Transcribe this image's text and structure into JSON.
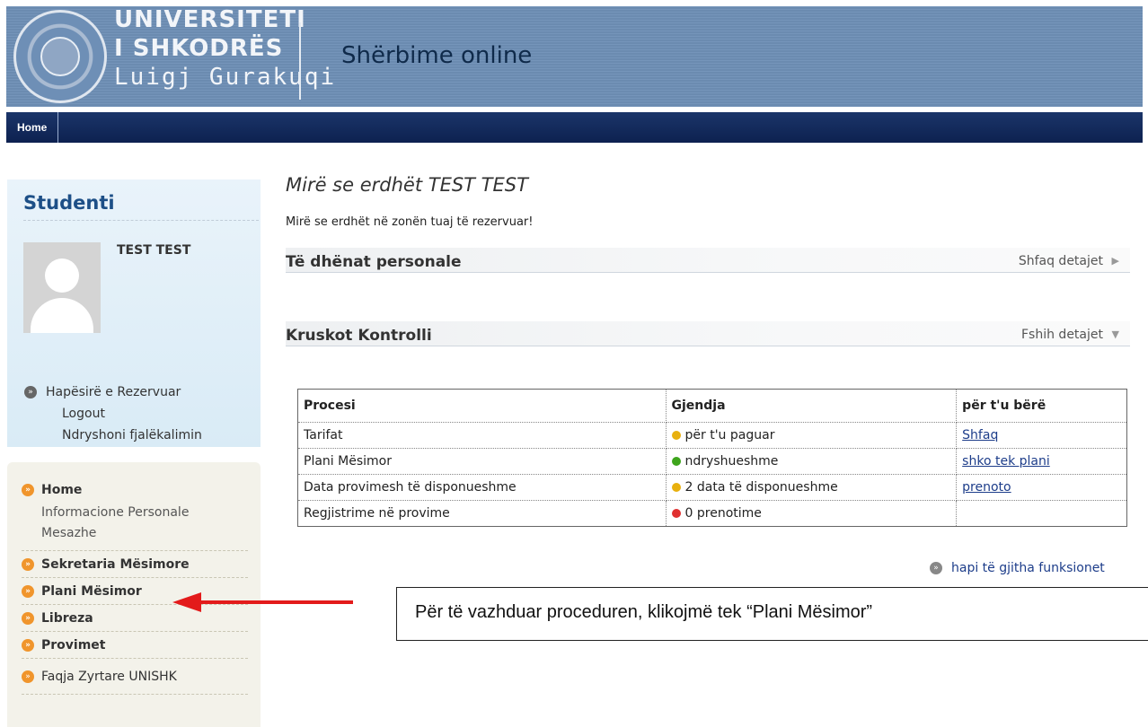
{
  "header": {
    "university_line1": "UNIVERSITETI",
    "university_line2": "I SHKODRËS",
    "university_line3": "Luigj Gurakuqi",
    "service_title": "Shërbime online",
    "logo_icon": "university-seal-icon"
  },
  "navbar": {
    "home_label": "Home"
  },
  "sidebar": {
    "title": "Studenti",
    "student_name": "TEST TEST",
    "links": [
      "Hapësirë e Rezervuar",
      "Logout",
      "Ndryshoni fjalëkalimin"
    ],
    "menu": {
      "home": "Home",
      "home_sub": [
        "Informacione Personale",
        "Mesazhe"
      ],
      "items": [
        "Sekretaria Mësimore",
        "Plani Mësimor",
        "Libreza",
        "Provimet",
        "Faqja Zyrtare UNISHK"
      ]
    }
  },
  "main": {
    "title": "Mirë se erdhët  TEST TEST",
    "subtitle": "Mirë se erdhët në zonën tuaj të rezervuar!",
    "personal_section": {
      "title": "Të dhënat personale",
      "toggle": "Shfaq detajet"
    },
    "control_section": {
      "title": "Kruskot Kontrolli",
      "toggle": "Fshih detajet"
    },
    "table": {
      "headers": [
        "Procesi",
        "Gjendja",
        "për t'u bërë"
      ],
      "rows": [
        {
          "process": "Tarifat",
          "status": "për t'u paguar",
          "status_color": "#e8b00e",
          "action": "Shfaq"
        },
        {
          "process": "Plani Mësimor",
          "status": "ndryshueshme",
          "status_color": "#3ea51c",
          "action": "shko tek plani"
        },
        {
          "process": "Data provimesh të disponueshme",
          "status": "2 data të disponueshme",
          "status_color": "#e8b00e",
          "action": "prenoto"
        },
        {
          "process": "Regjistrime në provime",
          "status": "0 prenotime",
          "status_color": "#e03030",
          "action": ""
        }
      ]
    },
    "all_functions_link": "hapi të gjitha funksionet"
  },
  "annotation": {
    "text": "Për të vazhduar proceduren, klikojmë tek “Plani Mësimor”",
    "arrow_color": "#e31b1b"
  }
}
